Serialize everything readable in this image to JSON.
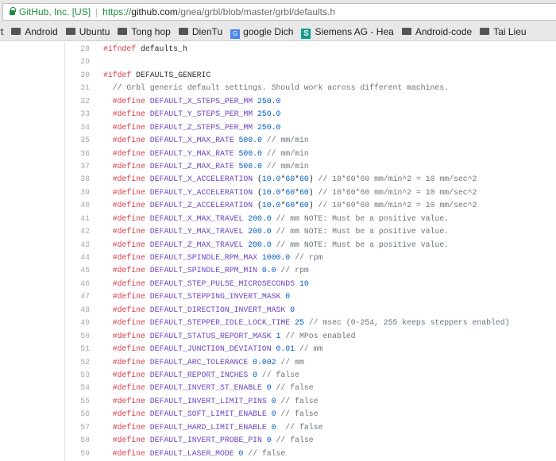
{
  "browser": {
    "security_label": "GitHub, Inc. [US]",
    "url": {
      "scheme": "https://",
      "host": "github.com",
      "path": "/gnea/grbl/blob/master/grbl/defaults.h"
    },
    "bookmarks": [
      {
        "label": "rt",
        "icon": "none"
      },
      {
        "label": "Android",
        "icon": "folder-icon"
      },
      {
        "label": "Ubuntu",
        "icon": "folder-icon"
      },
      {
        "label": "Tong hop",
        "icon": "folder-icon"
      },
      {
        "label": "DienTu",
        "icon": "folder-icon"
      },
      {
        "label": "google Dich",
        "icon": "google-translate-icon"
      },
      {
        "label": "Siemens AG - Hea",
        "icon": "siemens-icon"
      },
      {
        "label": "Android-code",
        "icon": "folder-icon"
      },
      {
        "label": "Tai Lieu",
        "icon": "folder-icon"
      }
    ]
  },
  "colors": {
    "keyword": "#d73a49",
    "macro": "#6f42c1",
    "number": "#005cc5",
    "comment": "#6a737d"
  },
  "code": {
    "lines": [
      {
        "n": "28",
        "tokens": [
          [
            "kw",
            "#ifndef"
          ],
          [
            "txt",
            " defaults_h"
          ]
        ]
      },
      {
        "n": "29",
        "tokens": []
      },
      {
        "n": "30",
        "tokens": [
          [
            "kw",
            "#ifdef"
          ],
          [
            "txt",
            " DEFAULTS_GENERIC"
          ]
        ]
      },
      {
        "n": "31",
        "tokens": [
          [
            "com",
            "  // Grbl generic default settings. Should work across different machines."
          ]
        ]
      },
      {
        "n": "32",
        "tokens": [
          [
            "kw",
            "  #define"
          ],
          [
            "mac",
            " DEFAULT_X_STEPS_PER_MM"
          ],
          [
            "num",
            " 250.0"
          ]
        ]
      },
      {
        "n": "33",
        "tokens": [
          [
            "kw",
            "  #define"
          ],
          [
            "mac",
            " DEFAULT_Y_STEPS_PER_MM"
          ],
          [
            "num",
            " 250.0"
          ]
        ]
      },
      {
        "n": "34",
        "tokens": [
          [
            "kw",
            "  #define"
          ],
          [
            "mac",
            " DEFAULT_Z_STEPS_PER_MM"
          ],
          [
            "num",
            " 250.0"
          ]
        ]
      },
      {
        "n": "35",
        "tokens": [
          [
            "kw",
            "  #define"
          ],
          [
            "mac",
            " DEFAULT_X_MAX_RATE"
          ],
          [
            "num",
            " 500.0"
          ],
          [
            "com",
            " // mm/min"
          ]
        ]
      },
      {
        "n": "36",
        "tokens": [
          [
            "kw",
            "  #define"
          ],
          [
            "mac",
            " DEFAULT_Y_MAX_RATE"
          ],
          [
            "num",
            " 500.0"
          ],
          [
            "com",
            " // mm/min"
          ]
        ]
      },
      {
        "n": "37",
        "tokens": [
          [
            "kw",
            "  #define"
          ],
          [
            "mac",
            " DEFAULT_Z_MAX_RATE"
          ],
          [
            "num",
            " 500.0"
          ],
          [
            "com",
            " // mm/min"
          ]
        ]
      },
      {
        "n": "38",
        "tokens": [
          [
            "kw",
            "  #define"
          ],
          [
            "mac",
            " DEFAULT_X_ACCELERATION"
          ],
          [
            "txt",
            " ("
          ],
          [
            "num",
            "10.0"
          ],
          [
            "txt",
            "*"
          ],
          [
            "num",
            "60"
          ],
          [
            "txt",
            "*"
          ],
          [
            "num",
            "60"
          ],
          [
            "txt",
            ")"
          ],
          [
            "com",
            " // 10*60*60 mm/min^2 = 10 mm/sec^2"
          ]
        ]
      },
      {
        "n": "39",
        "tokens": [
          [
            "kw",
            "  #define"
          ],
          [
            "mac",
            " DEFAULT_Y_ACCELERATION"
          ],
          [
            "txt",
            " ("
          ],
          [
            "num",
            "10.0"
          ],
          [
            "txt",
            "*"
          ],
          [
            "num",
            "60"
          ],
          [
            "txt",
            "*"
          ],
          [
            "num",
            "60"
          ],
          [
            "txt",
            ")"
          ],
          [
            "com",
            " // 10*60*60 mm/min^2 = 10 mm/sec^2"
          ]
        ]
      },
      {
        "n": "40",
        "tokens": [
          [
            "kw",
            "  #define"
          ],
          [
            "mac",
            " DEFAULT_Z_ACCELERATION"
          ],
          [
            "txt",
            " ("
          ],
          [
            "num",
            "10.0"
          ],
          [
            "txt",
            "*"
          ],
          [
            "num",
            "60"
          ],
          [
            "txt",
            "*"
          ],
          [
            "num",
            "60"
          ],
          [
            "txt",
            ")"
          ],
          [
            "com",
            " // 10*60*60 mm/min^2 = 10 mm/sec^2"
          ]
        ]
      },
      {
        "n": "41",
        "tokens": [
          [
            "kw",
            "  #define"
          ],
          [
            "mac",
            " DEFAULT_X_MAX_TRAVEL"
          ],
          [
            "num",
            " 200.0"
          ],
          [
            "com",
            " // mm NOTE: Must be a positive value."
          ]
        ]
      },
      {
        "n": "42",
        "tokens": [
          [
            "kw",
            "  #define"
          ],
          [
            "mac",
            " DEFAULT_Y_MAX_TRAVEL"
          ],
          [
            "num",
            " 200.0"
          ],
          [
            "com",
            " // mm NOTE: Must be a positive value."
          ]
        ]
      },
      {
        "n": "43",
        "tokens": [
          [
            "kw",
            "  #define"
          ],
          [
            "mac",
            " DEFAULT_Z_MAX_TRAVEL"
          ],
          [
            "num",
            " 200.0"
          ],
          [
            "com",
            " // mm NOTE: Must be a positive value."
          ]
        ]
      },
      {
        "n": "44",
        "tokens": [
          [
            "kw",
            "  #define"
          ],
          [
            "mac",
            " DEFAULT_SPINDLE_RPM_MAX"
          ],
          [
            "num",
            " 1000.0"
          ],
          [
            "com",
            " // rpm"
          ]
        ]
      },
      {
        "n": "45",
        "tokens": [
          [
            "kw",
            "  #define"
          ],
          [
            "mac",
            " DEFAULT_SPINDLE_RPM_MIN"
          ],
          [
            "num",
            " 0.0"
          ],
          [
            "com",
            " // rpm"
          ]
        ]
      },
      {
        "n": "46",
        "tokens": [
          [
            "kw",
            "  #define"
          ],
          [
            "mac",
            " DEFAULT_STEP_PULSE_MICROSECONDS"
          ],
          [
            "num",
            " 10"
          ]
        ]
      },
      {
        "n": "47",
        "tokens": [
          [
            "kw",
            "  #define"
          ],
          [
            "mac",
            " DEFAULT_STEPPING_INVERT_MASK"
          ],
          [
            "num",
            " 0"
          ]
        ]
      },
      {
        "n": "48",
        "tokens": [
          [
            "kw",
            "  #define"
          ],
          [
            "mac",
            " DEFAULT_DIRECTION_INVERT_MASK"
          ],
          [
            "num",
            " 0"
          ]
        ]
      },
      {
        "n": "49",
        "tokens": [
          [
            "kw",
            "  #define"
          ],
          [
            "mac",
            " DEFAULT_STEPPER_IDLE_LOCK_TIME"
          ],
          [
            "num",
            " 25"
          ],
          [
            "com",
            " // msec (0-254, 255 keeps steppers enabled)"
          ]
        ]
      },
      {
        "n": "50",
        "tokens": [
          [
            "kw",
            "  #define"
          ],
          [
            "mac",
            " DEFAULT_STATUS_REPORT_MASK"
          ],
          [
            "num",
            " 1"
          ],
          [
            "com",
            " // MPos enabled"
          ]
        ]
      },
      {
        "n": "51",
        "tokens": [
          [
            "kw",
            "  #define"
          ],
          [
            "mac",
            " DEFAULT_JUNCTION_DEVIATION"
          ],
          [
            "num",
            " 0.01"
          ],
          [
            "com",
            " // mm"
          ]
        ]
      },
      {
        "n": "52",
        "tokens": [
          [
            "kw",
            "  #define"
          ],
          [
            "mac",
            " DEFAULT_ARC_TOLERANCE"
          ],
          [
            "num",
            " 0.002"
          ],
          [
            "com",
            " // mm"
          ]
        ]
      },
      {
        "n": "53",
        "tokens": [
          [
            "kw",
            "  #define"
          ],
          [
            "mac",
            " DEFAULT_REPORT_INCHES"
          ],
          [
            "num",
            " 0"
          ],
          [
            "com",
            " // false"
          ]
        ]
      },
      {
        "n": "54",
        "tokens": [
          [
            "kw",
            "  #define"
          ],
          [
            "mac",
            " DEFAULT_INVERT_ST_ENABLE"
          ],
          [
            "num",
            " 0"
          ],
          [
            "com",
            " // false"
          ]
        ]
      },
      {
        "n": "55",
        "tokens": [
          [
            "kw",
            "  #define"
          ],
          [
            "mac",
            " DEFAULT_INVERT_LIMIT_PINS"
          ],
          [
            "num",
            " 0"
          ],
          [
            "com",
            " // false"
          ]
        ]
      },
      {
        "n": "56",
        "tokens": [
          [
            "kw",
            "  #define"
          ],
          [
            "mac",
            " DEFAULT_SOFT_LIMIT_ENABLE"
          ],
          [
            "num",
            " 0"
          ],
          [
            "com",
            " // false"
          ]
        ]
      },
      {
        "n": "57",
        "tokens": [
          [
            "kw",
            "  #define"
          ],
          [
            "mac",
            " DEFAULT_HARD_LIMIT_ENABLE"
          ],
          [
            "num",
            " 0"
          ],
          [
            "com",
            "  // false"
          ]
        ]
      },
      {
        "n": "58",
        "tokens": [
          [
            "kw",
            "  #define"
          ],
          [
            "mac",
            " DEFAULT_INVERT_PROBE_PIN"
          ],
          [
            "num",
            " 0"
          ],
          [
            "com",
            " // false"
          ]
        ]
      },
      {
        "n": "59",
        "tokens": [
          [
            "kw",
            "  #define"
          ],
          [
            "mac",
            " DEFAULT_LASER_MODE"
          ],
          [
            "num",
            " 0"
          ],
          [
            "com",
            " // false"
          ]
        ]
      }
    ]
  }
}
